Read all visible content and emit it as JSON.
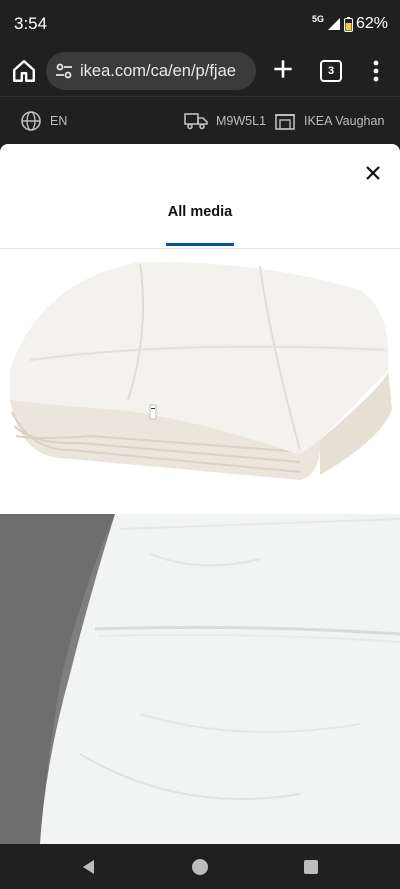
{
  "status_bar": {
    "time": "3:54",
    "network": "5G",
    "battery": "62%"
  },
  "browser": {
    "url": "ikea.com/ca/en/p/fjae",
    "tab_count": "3"
  },
  "utility_bar": {
    "language": "EN",
    "postal_code": "M9W5L1",
    "store": "IKEA Vaughan"
  },
  "media_viewer": {
    "tab_label": "All media",
    "accent_color": "#0058a3"
  },
  "icons": [
    "home-icon",
    "tune-icon",
    "plus-icon",
    "tab-switcher-icon",
    "more-vert-icon",
    "globe-icon",
    "truck-icon",
    "store-icon",
    "close-icon",
    "back-icon",
    "home-circle-icon",
    "recents-icon"
  ]
}
